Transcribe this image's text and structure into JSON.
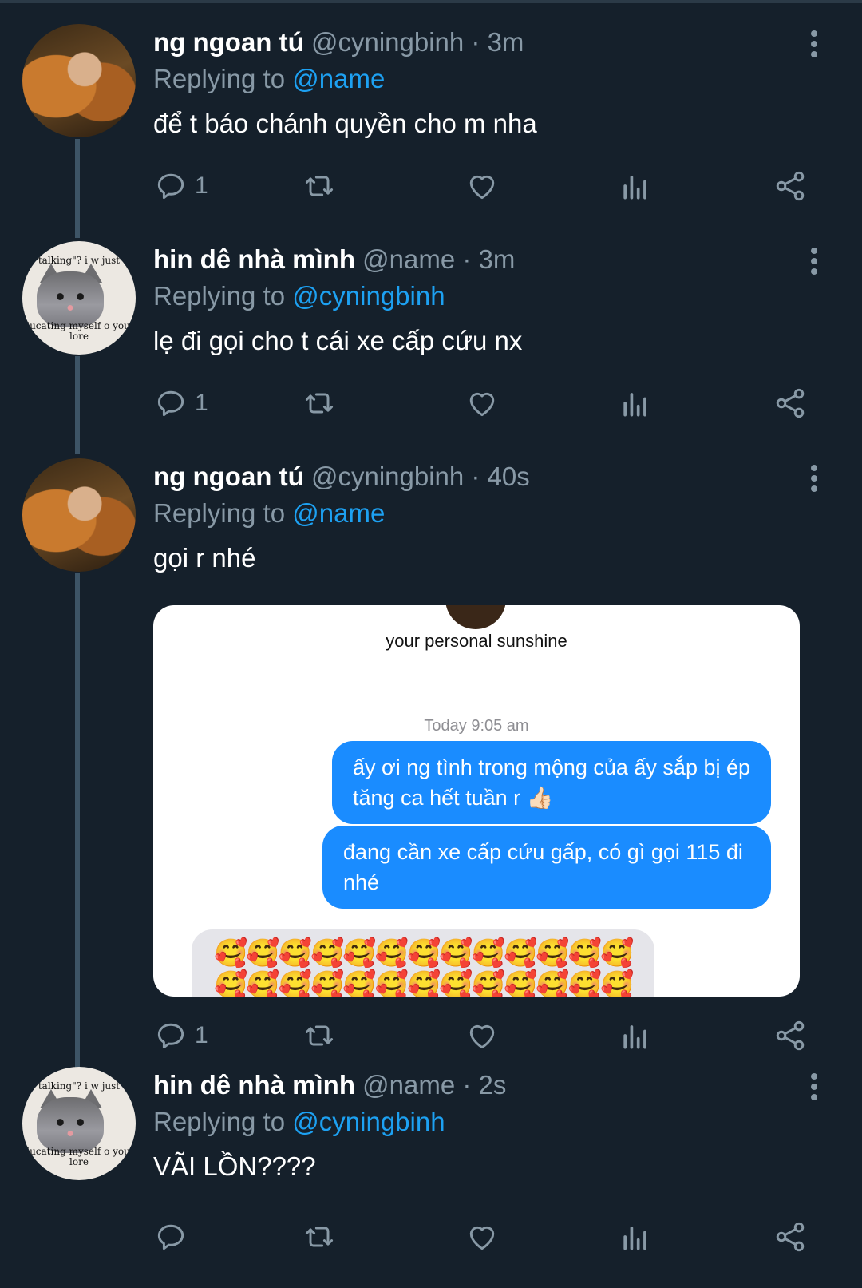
{
  "tweets": [
    {
      "name": "ng ngoan tú",
      "handle": "@cyningbinh · 3m",
      "replying_label": "Replying to",
      "replying_to": "@name",
      "text": "để t báo chánh quyền cho m nha",
      "reply_count": "1",
      "avatar": "girl"
    },
    {
      "name": "hin dê nhà mình",
      "handle": "@name · 3m",
      "replying_label": "Replying to",
      "replying_to": "@cyningbinh",
      "text": "lẹ đi gọi cho t cái xe cấp cứu nx",
      "reply_count": "1",
      "avatar": "cat",
      "avatar_caption_top": "talking\"? i w just",
      "avatar_caption_bottom": "ducating myself o your lore"
    },
    {
      "name": "ng ngoan tú",
      "handle": "@cyningbinh · 40s",
      "replying_label": "Replying to",
      "replying_to": "@name",
      "text": "gọi r nhé",
      "reply_count": "1",
      "avatar": "girl",
      "media": {
        "contact_name": "your personal sunshine",
        "timestamp_day": "Today",
        "timestamp_time": "9:05 am",
        "message1": "ấy ơi ng tình trong mộng của ấy sắp bị ép tăng ca hết tuần r 👍🏻",
        "message2": "đang cần xe cấp cứu gấp, có gì gọi 115 đi nhé",
        "reply_emojis": "🥰🥰🥰🥰🥰🥰🥰🥰🥰🥰🥰🥰🥰🥰🥰🥰🥰🥰🥰🥰🥰🥰🥰🥰🥰🥰"
      }
    },
    {
      "name": "hin dê nhà mình",
      "handle": "@name · 2s",
      "replying_label": "Replying to",
      "replying_to": "@cyningbinh",
      "text": "VÃI LỒN????",
      "reply_count": "",
      "avatar": "cat",
      "avatar_caption_top": "talking\"? i w just",
      "avatar_caption_bottom": "ducating myself o your lore"
    }
  ],
  "icons": {
    "reply": "reply-icon",
    "retweet": "retweet-icon",
    "like": "heart-icon",
    "analytics": "analytics-icon",
    "share": "share-icon",
    "more": "more-vertical-icon"
  },
  "colors": {
    "background": "#15202b",
    "accent": "#1da1f2",
    "muted": "#8899a6",
    "imessage_blue": "#1a8cff"
  }
}
